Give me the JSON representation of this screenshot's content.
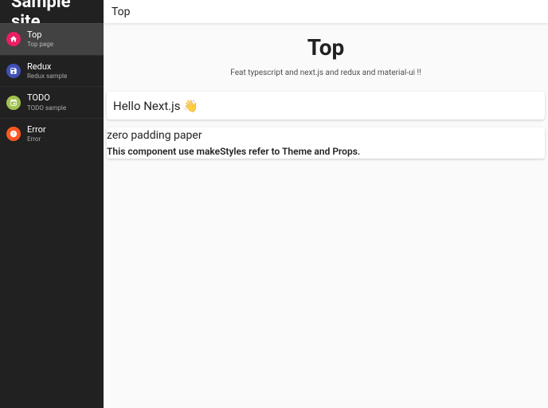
{
  "header": {
    "site_name": "Sample site"
  },
  "sidebar": {
    "items": [
      {
        "title": "Top",
        "sub": "Top page"
      },
      {
        "title": "Redux",
        "sub": "Redux sample"
      },
      {
        "title": "TODO",
        "sub": "TODO sample"
      },
      {
        "title": "Error",
        "sub": "Error"
      }
    ]
  },
  "topbar": {
    "title": "Top"
  },
  "hero": {
    "title": "Top",
    "subtitle": "Feat typescript and next.js and redux and material-ui !!"
  },
  "papers": [
    {
      "text": "Hello Next.js 👋"
    },
    {
      "title": "zero padding paper",
      "body": "This component use makeStyles refer to Theme and Props."
    }
  ]
}
